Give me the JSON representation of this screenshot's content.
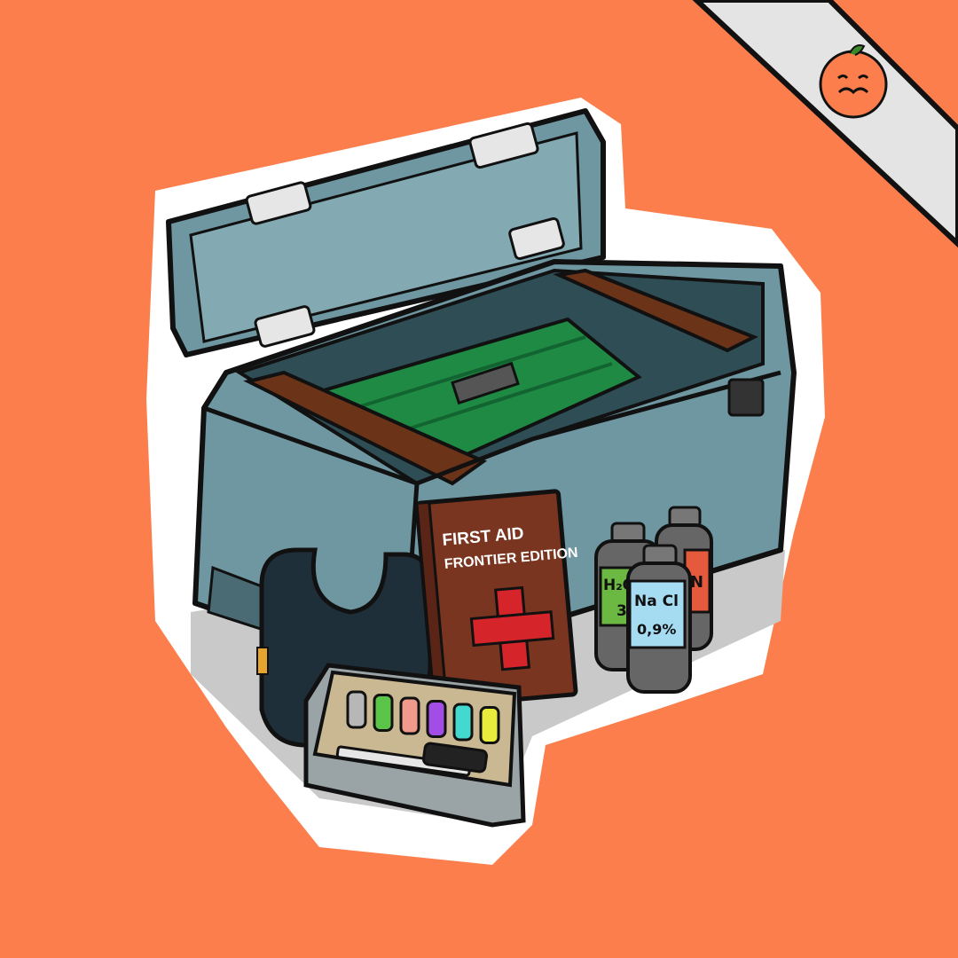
{
  "palette": {
    "background": "#fb7e4c",
    "sticker_border": "#ffffff",
    "chest_steel": "#6f97a1",
    "chest_dark": "#4a6b74",
    "tray_green": "#1f8a43",
    "wood": "#6b3318",
    "book_cover": "#7a3520",
    "red_cross": "#d5242a",
    "outline": "#111111",
    "banner": "#e4e4e4"
  },
  "book": {
    "title_line1": "FIRST AID",
    "title_line2": "FRONTIER EDITION"
  },
  "bottles": {
    "peroxide_formula": "H₂O₂",
    "peroxide_percent": "3%",
    "saline_label": "Na Cl",
    "saline_percent": "0,9%",
    "third_label": "N"
  },
  "vial_colors": [
    "#b7b7b7",
    "#5cc449",
    "#f09a8c",
    "#a24ee6",
    "#43d9cf",
    "#e8ec3c"
  ],
  "watermark": {
    "icon": "tomato-mascot-icon"
  }
}
